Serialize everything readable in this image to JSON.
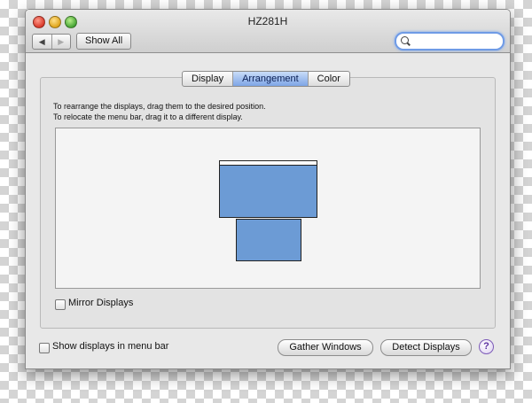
{
  "window": {
    "title": "HZ281H"
  },
  "toolbar": {
    "back_glyph": "◀",
    "forward_glyph": "▶",
    "show_all_label": "Show All",
    "search_placeholder": ""
  },
  "tabs": [
    {
      "label": "Display",
      "active": false
    },
    {
      "label": "Arrangement",
      "active": true
    },
    {
      "label": "Color",
      "active": false
    }
  ],
  "instructions": {
    "line1": "To rearrange the displays, drag them to the desired position.",
    "line2": "To relocate the menu bar, drag it to a different display."
  },
  "mirror_displays": {
    "label": "Mirror Displays",
    "checked": false
  },
  "footer": {
    "show_in_menu_bar_label": "Show displays in menu bar",
    "show_in_menu_bar_checked": false,
    "gather_windows_label": "Gather Windows",
    "detect_displays_label": "Detect Displays",
    "help_label": "?"
  },
  "colors": {
    "display_fill": "#6c9bd5",
    "active_tab": "#7ea5e6",
    "search_focus": "#6f9be6"
  },
  "icons": [
    "search-icon",
    "back-arrow-icon",
    "forward-arrow-icon",
    "help-icon"
  ]
}
